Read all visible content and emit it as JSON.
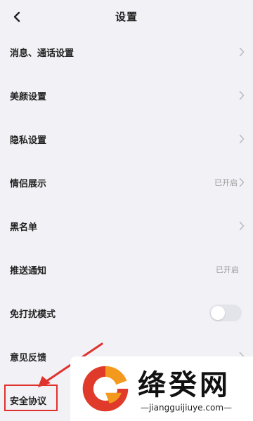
{
  "header": {
    "title": "设置"
  },
  "settings": {
    "items": [
      {
        "label": "消息、通话设置"
      },
      {
        "label": "美颜设置"
      },
      {
        "label": "隐私设置"
      },
      {
        "label": "情侣展示",
        "status": "已开启"
      },
      {
        "label": "黑名单"
      },
      {
        "label": "推送通知",
        "status": "已开启"
      },
      {
        "label": "免打扰模式",
        "toggle_on": false
      },
      {
        "label": "意见反馈"
      },
      {
        "label": "安全协议"
      }
    ]
  },
  "watermark": {
    "brand": "绛癸网",
    "url": "—jiangguijiuye.com—"
  },
  "colors": {
    "background": "#f2f1f6",
    "highlight": "#e0322c",
    "logo_orange": "#f39a1e",
    "logo_red": "#e03a2a"
  }
}
